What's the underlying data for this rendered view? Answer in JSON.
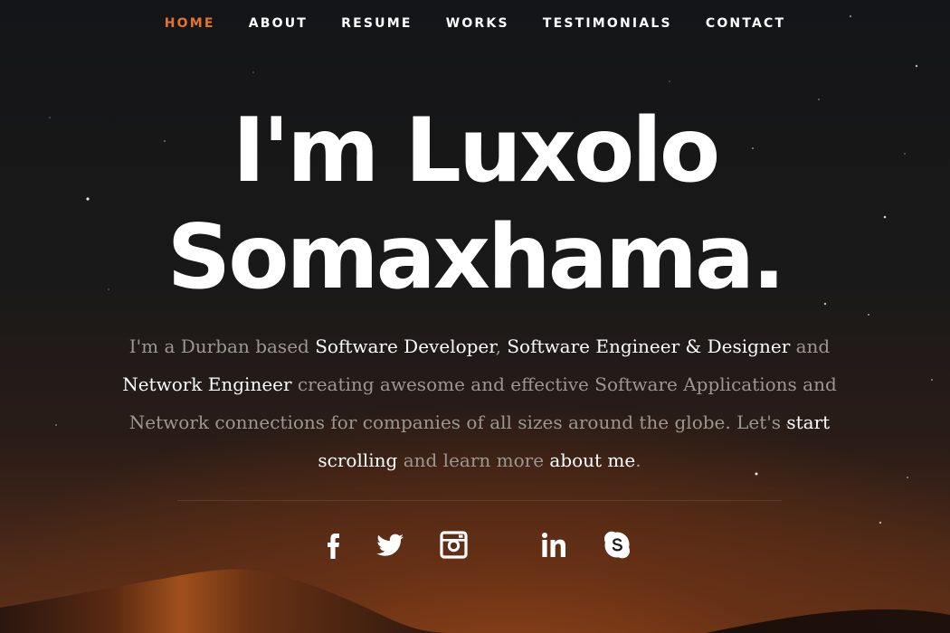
{
  "nav": {
    "items": [
      {
        "label": "HOME",
        "active": true
      },
      {
        "label": "ABOUT",
        "active": false
      },
      {
        "label": "RESUME",
        "active": false
      },
      {
        "label": "WORKS",
        "active": false
      },
      {
        "label": "TESTIMONIALS",
        "active": false
      },
      {
        "label": "CONTACT",
        "active": false
      }
    ],
    "active_color": "#e4742a"
  },
  "hero": {
    "line1": "I'm Luxolo",
    "line2": "Somaxhama.",
    "intro": {
      "t1": "I'm a Durban based ",
      "h1": "Software Developer",
      "t2": ", ",
      "h2": "Software Engineer & Designer",
      "t3": " and ",
      "h3": "Network Engineer",
      "t4": " creating awesome and effective Software Applications and Network connections for companies of all sizes around the globe. Let's ",
      "h4": "start scrolling",
      "t5": " and learn more ",
      "h5": "about me",
      "t6": "."
    }
  },
  "social": [
    {
      "icon": "facebook-icon"
    },
    {
      "icon": "twitter-icon"
    },
    {
      "icon": "instagram-icon"
    },
    {
      "icon": "linkedin-icon"
    },
    {
      "icon": "skype-icon"
    }
  ]
}
